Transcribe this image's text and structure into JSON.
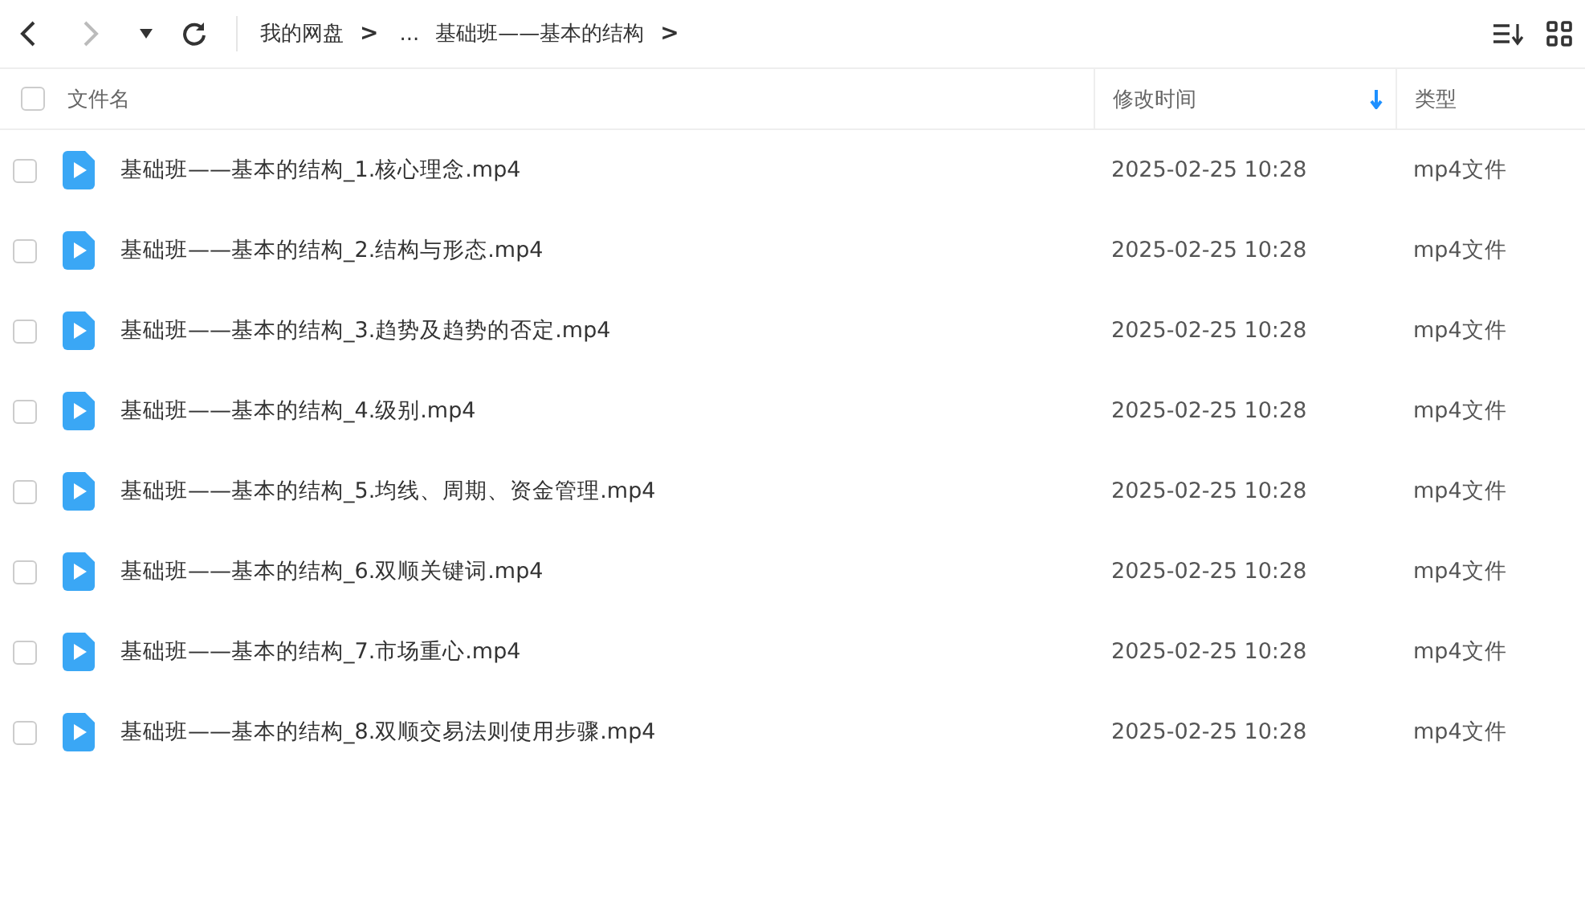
{
  "breadcrumb": [
    {
      "label": "我的网盘",
      "kind": "link"
    },
    {
      "label": ">",
      "kind": "sep"
    },
    {
      "label": "...",
      "kind": "link"
    },
    {
      "label": "基础班——基本的结构",
      "kind": "link"
    },
    {
      "label": ">",
      "kind": "sep"
    }
  ],
  "table": {
    "select_all": {
      "checked": false
    },
    "columns": [
      {
        "label": "文件名",
        "sorted": false
      },
      {
        "label": "修改时间",
        "sorted": true
      },
      {
        "label": "类型",
        "sorted": false
      }
    ],
    "rows": [
      {
        "name": "基础班——基本的结构_1.核心理念.mp4",
        "modified": "2025-02-25 10:28",
        "type": "mp4文件",
        "checked": false
      },
      {
        "name": "基础班——基本的结构_2.结构与形态.mp4",
        "modified": "2025-02-25 10:28",
        "type": "mp4文件",
        "checked": false
      },
      {
        "name": "基础班——基本的结构_3.趋势及趋势的否定.mp4",
        "modified": "2025-02-25 10:28",
        "type": "mp4文件",
        "checked": false
      },
      {
        "name": "基础班——基本的结构_4.级别.mp4",
        "modified": "2025-02-25 10:28",
        "type": "mp4文件",
        "checked": false
      },
      {
        "name": "基础班——基本的结构_5.均线、周期、资金管理.mp4",
        "modified": "2025-02-25 10:28",
        "type": "mp4文件",
        "checked": false
      },
      {
        "name": "基础班——基本的结构_6.双顺关键词.mp4",
        "modified": "2025-02-25 10:28",
        "type": "mp4文件",
        "checked": false
      },
      {
        "name": "基础班——基本的结构_7.市场重心.mp4",
        "modified": "2025-02-25 10:28",
        "type": "mp4文件",
        "checked": false
      },
      {
        "name": "基础班——基本的结构_8.双顺交易法则使用步骤.mp4",
        "modified": "2025-02-25 10:28",
        "type": "mp4文件",
        "checked": false
      }
    ]
  }
}
